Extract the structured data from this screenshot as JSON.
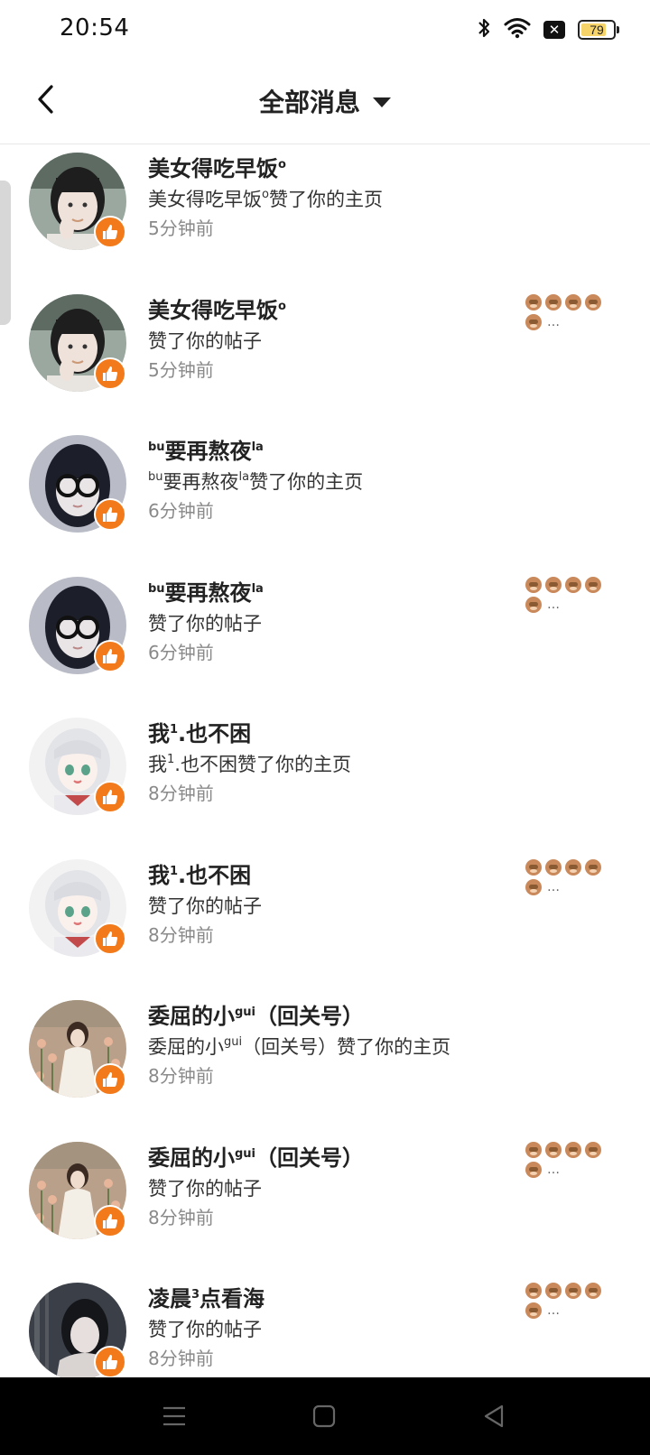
{
  "status_bar": {
    "time": "20:54",
    "battery": "79",
    "battery_fraction": 0.79,
    "icons": [
      "bluetooth-icon",
      "wifi-icon",
      "close-badge-icon",
      "battery-icon"
    ]
  },
  "header": {
    "title": "全部消息",
    "back_icon": "chevron-left-icon",
    "dropdown_icon": "caret-down-icon"
  },
  "colors": {
    "accent": "#f27a1a",
    "text_primary": "#222222",
    "text_secondary": "#8a8a8a",
    "divider": "#e8e8e8"
  },
  "messages": [
    {
      "name": "美女得吃早饭",
      "name_sup": "o",
      "name_tail": "",
      "action_pre": "美女得吃早饭",
      "action_sup": "o",
      "action_mid": "",
      "action": "赞了你的主页",
      "time": "5分钟前",
      "has_preview": false,
      "avatar_theme": "girl-dark"
    },
    {
      "name": "美女得吃早饭",
      "name_sup": "o",
      "name_tail": "",
      "action_pre": "",
      "action_sup": "",
      "action_mid": "",
      "action": "赞了你的帖子",
      "time": "5分钟前",
      "has_preview": true,
      "preview_text": "…",
      "avatar_theme": "girl-dark"
    },
    {
      "name": "要再熬夜",
      "name_pre_sup": "bu",
      "name_sup": "la",
      "name_tail": "",
      "action_pre_sup": "bu",
      "action_pre": "要再熬夜",
      "action_sup": "la",
      "action_mid": "",
      "action": "赞了你的主页",
      "time": "6分钟前",
      "has_preview": false,
      "avatar_theme": "glasses"
    },
    {
      "name": "要再熬夜",
      "name_pre_sup": "bu",
      "name_sup": "la",
      "name_tail": "",
      "action_pre": "",
      "action_sup": "",
      "action_mid": "",
      "action": "赞了你的帖子",
      "time": "6分钟前",
      "has_preview": true,
      "preview_text": "…",
      "avatar_theme": "glasses"
    },
    {
      "name": "我",
      "name_sup": "1",
      "name_tail": ".也不困",
      "action_pre": "我",
      "action_sup": "1",
      "action_mid": ".也不困",
      "action": "赞了你的主页",
      "time": "8分钟前",
      "has_preview": false,
      "avatar_theme": "anime"
    },
    {
      "name": "我",
      "name_sup": "1",
      "name_tail": ".也不困",
      "action_pre": "",
      "action_sup": "",
      "action_mid": "",
      "action": "赞了你的帖子",
      "time": "8分钟前",
      "has_preview": true,
      "preview_text": "…",
      "avatar_theme": "anime"
    },
    {
      "name": "委屈的小",
      "name_sup": "gui",
      "name_tail": "（回关号）",
      "action_pre": "委屈的小",
      "action_sup": "gui",
      "action_mid": "（回关号）",
      "action": "赞了你的主页",
      "time": "8分钟前",
      "has_preview": false,
      "avatar_theme": "flowers"
    },
    {
      "name": "委屈的小",
      "name_sup": "gui",
      "name_tail": "（回关号）",
      "action_pre": "",
      "action_sup": "",
      "action_mid": "",
      "action": "赞了你的帖子",
      "time": "8分钟前",
      "has_preview": true,
      "preview_text": "…",
      "avatar_theme": "flowers"
    },
    {
      "name": "凌晨",
      "name_sup": "3",
      "name_tail": "点看海",
      "action_pre": "",
      "action_sup": "",
      "action_mid": "",
      "action": "赞了你的帖子",
      "time": "8分钟前",
      "has_preview": true,
      "preview_text": "…",
      "avatar_theme": "night"
    }
  ],
  "nav_bar": {
    "buttons": [
      "menu-icon",
      "home-square-icon",
      "back-triangle-icon"
    ]
  }
}
